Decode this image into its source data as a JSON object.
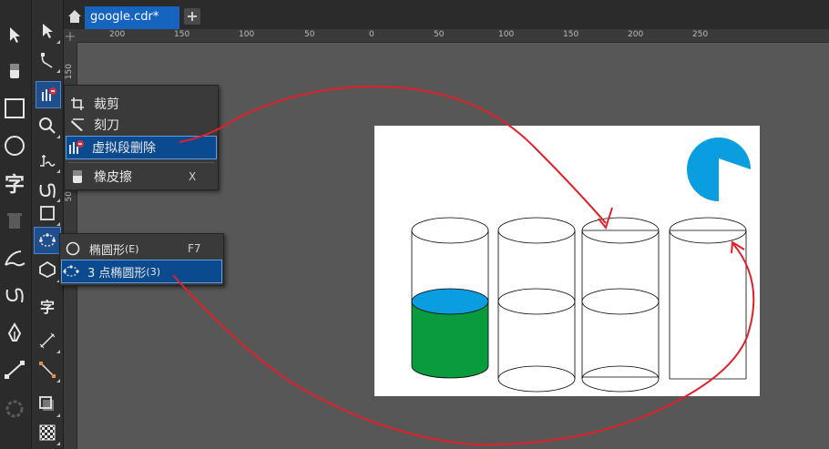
{
  "tab": {
    "title": "google.cdr*"
  },
  "ruler": {
    "h_ticks": [
      "200",
      "150",
      "100",
      "50",
      "0",
      "50",
      "100",
      "150",
      "200",
      "250"
    ],
    "v_ticks": [
      "150",
      "100",
      "50",
      "0"
    ]
  },
  "flyout_trim": {
    "items": [
      {
        "label": "裁剪",
        "icon": "crop-icon"
      },
      {
        "label": "刻刀",
        "icon": "knife-icon"
      },
      {
        "label": "虚拟段删除",
        "icon": "virtual-segment-delete-icon",
        "selected": true
      },
      {
        "label": "橡皮擦",
        "shortcut": "X",
        "icon": "eraser-icon"
      }
    ]
  },
  "flyout_ellipse": {
    "items": [
      {
        "label": "椭圆形",
        "mnemonic": "(E)",
        "shortcut": "F7",
        "icon": "ellipse-icon"
      },
      {
        "label": "3 点椭圆形",
        "mnemonic": "(3)",
        "icon": "three-point-ellipse-icon",
        "selected": true
      }
    ]
  },
  "outer_tools": [
    "pick-tool-icon",
    "eraser-tool-icon",
    "rectangle-tool-icon",
    "ellipse-tool-icon",
    "text-tool-icon",
    "delete-icon",
    "artistic-media-icon",
    "freehand-icon",
    "pen-tool-icon",
    "connector-tool-icon",
    "gear-icon"
  ],
  "inner_tools": [
    "pick-tool-icon",
    "shape-tool-icon",
    "crop-tool-icon",
    "zoom-tool-icon",
    "freehand-tool-icon",
    "curve-tool-icon",
    "rectangle-tool-icon",
    "ellipse-tool-icon",
    "polygon-tool-icon",
    "text-tool-icon",
    "dimension-tool-icon",
    "connector-tool-icon",
    "shadow-tool-icon",
    "transparency-tool-icon"
  ],
  "outer_text_tool_glyph": "字",
  "inner_text_tool_glyph": "字",
  "colors": {
    "accent": "#1565c0",
    "selection": "#0b4a8f",
    "water_top": "#0a9de0",
    "water_body": "#0a9b3e",
    "pacman": "#0a9de0",
    "annotation": "#e0202a"
  },
  "drawing": {
    "cylinders": [
      {
        "filled": true,
        "fill_level": 0.55
      },
      {
        "filled": false
      },
      {
        "filled": false
      },
      {
        "filled": false
      }
    ]
  }
}
